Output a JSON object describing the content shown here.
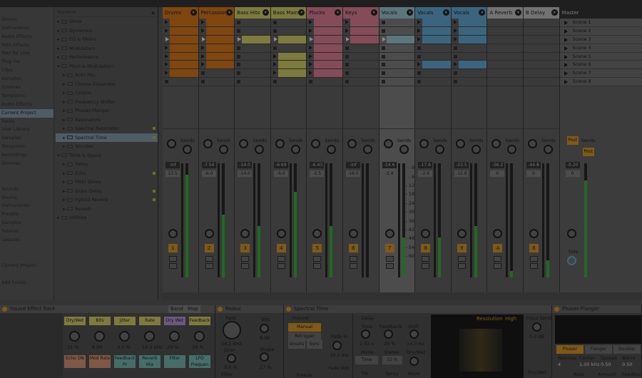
{
  "browser": {
    "places": [
      "",
      "Drums",
      "Instruments",
      "Audio Effects",
      "MIDI Effects",
      "Max for Live",
      "Plug-ins",
      "Clips",
      "Samples",
      "Grooves",
      "Templates",
      "Audio Effects",
      "Current Project",
      "Packs",
      "User Library",
      "Samples",
      "Templates",
      "Recordings",
      "Grooves",
      "",
      "",
      "Sounds",
      "Drums",
      "Instruments",
      "Presets",
      "Samples",
      "Tutorial",
      "Lessons",
      "",
      "",
      "Current Project",
      "",
      "Add Folder..."
    ],
    "selected_place": 12,
    "header": "Nombre",
    "rows": [
      {
        "label": "Drive",
        "arrow": "▸",
        "mark": false
      },
      {
        "label": "Dynamics",
        "arrow": "▸",
        "mark": false
      },
      {
        "label": "EQ & Filters",
        "arrow": "▸",
        "mark": false
      },
      {
        "label": "Modulators",
        "arrow": "▸",
        "mark": false
      },
      {
        "label": "Performance",
        "arrow": "▸",
        "mark": false
      },
      {
        "label": "Pitch & Modulation",
        "arrow": "▾",
        "mark": false
      },
      {
        "label": "Auto Pan",
        "arrow": "▸",
        "mark": false,
        "indent": true
      },
      {
        "label": "Chorus-Ensemble",
        "arrow": "▸",
        "mark": false,
        "indent": true
      },
      {
        "label": "Corpus",
        "arrow": "▸",
        "mark": false,
        "indent": true
      },
      {
        "label": "Frequency Shifter",
        "arrow": "▸",
        "mark": false,
        "indent": true
      },
      {
        "label": "Phaser-Flanger",
        "arrow": "▸",
        "mark": false,
        "indent": true
      },
      {
        "label": "Resonators",
        "arrow": "▸",
        "mark": false,
        "indent": true
      },
      {
        "label": "Spectral Resonator",
        "arrow": "▸",
        "mark": true,
        "indent": true
      },
      {
        "label": "Spectral Time",
        "arrow": "▸",
        "mark": true,
        "indent": true,
        "selected": true
      },
      {
        "label": "Vocoder",
        "arrow": "▸",
        "mark": false,
        "indent": true
      },
      {
        "label": "Time & Space",
        "arrow": "▾",
        "mark": false
      },
      {
        "label": "Delay",
        "arrow": "▸",
        "mark": false,
        "indent": true
      },
      {
        "label": "Echo",
        "arrow": "▸",
        "mark": true,
        "indent": true
      },
      {
        "label": "Filter Delay",
        "arrow": "▸",
        "mark": false,
        "indent": true
      },
      {
        "label": "Grain Delay",
        "arrow": "▸",
        "mark": true,
        "indent": true
      },
      {
        "label": "Hybrid Reverb",
        "arrow": "▸",
        "mark": true,
        "indent": true
      },
      {
        "label": "Reverb",
        "arrow": "▸",
        "mark": false,
        "indent": true
      },
      {
        "label": "Utilities",
        "arrow": "▸",
        "mark": false
      }
    ]
  },
  "tracks": [
    {
      "name": "Drums",
      "num": "1",
      "color": "#e8801e",
      "vol": "-inf",
      "pan": "13.5",
      "meter": 0.9,
      "peak": "",
      "clip_color": "#e8801e",
      "clips": [
        1,
        1,
        1,
        1,
        1,
        1,
        1,
        0
      ],
      "playing": 2,
      "sel": false
    },
    {
      "name": "Percussion",
      "num": "2",
      "color": "#e8801e",
      "vol": "-7.54",
      "pan": "-6.0",
      "meter": 0.55,
      "peak": "32",
      "clip_color": "#e8801e",
      "clips": [
        1,
        1,
        1,
        1,
        1,
        1,
        0,
        0
      ],
      "playing": 2,
      "sel": false
    },
    {
      "name": "Bass Hits",
      "num": "3",
      "color": "#e4e170",
      "vol": "-14.0",
      "pan": "-14.0",
      "meter": 0.45,
      "peak": "32",
      "clip_color": "#e4e170",
      "clips": [
        0,
        0,
        1,
        0,
        0,
        0,
        0,
        0
      ],
      "playing": 2,
      "sel": false
    },
    {
      "name": "Bass Main",
      "num": "4",
      "color": "#e4e170",
      "vol": "-6.69",
      "pan": "-6.0",
      "meter": 0.75,
      "peak": "32",
      "clip_color": "#e4e170",
      "clips": [
        0,
        0,
        1,
        0,
        1,
        1,
        1,
        0
      ],
      "playing": 2,
      "sel": false
    },
    {
      "name": "Plucks",
      "num": "5",
      "color": "#f08aa0",
      "vol": "-6.43",
      "pan": "-5.5",
      "meter": 0.45,
      "peak": "40",
      "clip_color": "#f08aa0",
      "clips": [
        1,
        1,
        1,
        1,
        1,
        1,
        1,
        0
      ],
      "playing": 2,
      "sel": false
    },
    {
      "name": "Keys",
      "num": "6",
      "color": "#f08aa0",
      "vol": "-inf",
      "pan": "-16.0",
      "meter": 0,
      "peak": "40",
      "clip_color": "#f08aa0",
      "clips": [
        1,
        1,
        1,
        0,
        0,
        0,
        0,
        0
      ],
      "playing": 2,
      "sel": false
    },
    {
      "name": "Vocals",
      "num": "7",
      "color": "#a8d8e0",
      "vol": "-14.6",
      "pan": "-3.4",
      "meter": 0.35,
      "peak": "",
      "clip_color": "#a8d8e0",
      "clips": [
        0,
        0,
        1,
        0,
        0,
        0,
        0,
        0
      ],
      "playing": 2,
      "sel": true
    },
    {
      "name": "Vocals",
      "num": "8",
      "color": "#6cb8e8",
      "vol": "-17.6",
      "pan": "-2.6",
      "meter": 0.35,
      "peak": "32",
      "clip_color": "#6cb8e8",
      "clips": [
        1,
        1,
        1,
        0,
        0,
        1,
        0,
        0
      ],
      "playing": -1,
      "sel": false
    },
    {
      "name": "Vocals",
      "num": "9",
      "color": "#6cb8e8",
      "vol": "-23.5",
      "pan": "-12.8",
      "meter": 0.45,
      "peak": "32",
      "clip_color": "#6cb8e8",
      "clips": [
        1,
        1,
        1,
        0,
        0,
        1,
        0,
        0
      ],
      "playing": -1,
      "sel": false
    },
    {
      "name": "A Reverb",
      "num": "A",
      "color": "#d0d0d0",
      "vol": "-36.2",
      "pan": "0",
      "meter": 0.06,
      "peak": "",
      "clip_color": "",
      "clips": [
        0,
        0,
        0,
        0,
        0,
        0,
        0,
        0
      ],
      "playing": -1,
      "sel": false
    },
    {
      "name": "B Delay",
      "num": "B",
      "color": "#d0d0d0",
      "vol": "-44.8",
      "pan": "0",
      "meter": 0.15,
      "peak": "",
      "clip_color": "",
      "clips": [
        0,
        0,
        0,
        0,
        0,
        0,
        0,
        0
      ],
      "playing": -1,
      "sel": false
    }
  ],
  "master": {
    "name": "Master",
    "vol": "-0.20",
    "pan": "0",
    "sends_label": "Sends",
    "post": "Post",
    "solo": "Solo",
    "meter": 0.85,
    "scenes": [
      "Scene 1",
      "Scene 2",
      "Scene 3",
      "Scene 4",
      "Scene 5",
      "Scene 6",
      "Scene 7",
      "Scene 8"
    ]
  },
  "mixer": {
    "sends_label": "Sends",
    "ticks": [
      "- 0",
      "- 6",
      "- 12",
      "- 18",
      "- 24",
      "- 30",
      "- 36",
      "- 42",
      "- 48",
      "- 54",
      "- 60"
    ]
  },
  "devices": {
    "rack": {
      "title": "Sound Effect Rack",
      "buttons": [
        "Dry/Wet",
        "Bits",
        "Jitter",
        "Rate",
        "Dry Wet",
        "Feedback"
      ],
      "values": [
        "31 %",
        "8.00",
        "3.0 %",
        "14.2 kHz",
        "29 %",
        "29 %"
      ],
      "bottom": [
        "Echo ON",
        "Mod Rate",
        "Feedback Pr",
        "Reverb Mix",
        "Filter",
        "LFO Frequen"
      ]
    },
    "redux": {
      "title": "Redux",
      "rate_label": "Rate",
      "rate_val": "14.2 kHz",
      "jitter_label": "Jitter",
      "jitter_val": "3.0 %",
      "bits_label": "Bits",
      "bits_val": "8.00",
      "shape_label": "Shape",
      "shape_val": "27 %",
      "filter": "Filter"
    },
    "spectral": {
      "title": "Spectral Time",
      "freezer": "Freezer",
      "manual": "Manual",
      "retrigger": "Retrigger",
      "onsets": "Onsets",
      "sync": "Sync",
      "fade_in": "Fade In",
      "fade_in_val": "10.2 ms",
      "fade_out": "Fade Out",
      "freeze": "Freeze",
      "delay": "Delay",
      "time": "Time",
      "time_val": "2.03 s",
      "feedback": "Feedback",
      "feedback_val": "29 %",
      "shift": "Shift",
      "shift_val": "14.0 Hz",
      "mode": "Mode",
      "mode_val": "Time",
      "stereo": "Stereo",
      "stereo_val": "33 %",
      "dry_wet": "Dry/Wet",
      "tilt": "Tilt",
      "spray": "Spray",
      "mask": "Mask",
      "resolution": "Resolution",
      "resolution_val": "High",
      "input_send": "Input Send",
      "input_send_val": "0.0 dB",
      "dry_wet2": "Dry/Wet"
    },
    "phaser": {
      "title": "Phaser-Flanger",
      "modes": [
        "Phaser",
        "Flanger",
        "Doubler"
      ],
      "labels": [
        "Notches",
        "Center",
        "Spread",
        "Blend"
      ],
      "values": [
        "4",
        "1.00 kHz",
        "0.50",
        "0.50"
      ],
      "bottom": [
        "Rate",
        "Amount",
        "Feedback"
      ]
    },
    "rack_labels": {
      "band": "Band",
      "map": "Map"
    }
  }
}
